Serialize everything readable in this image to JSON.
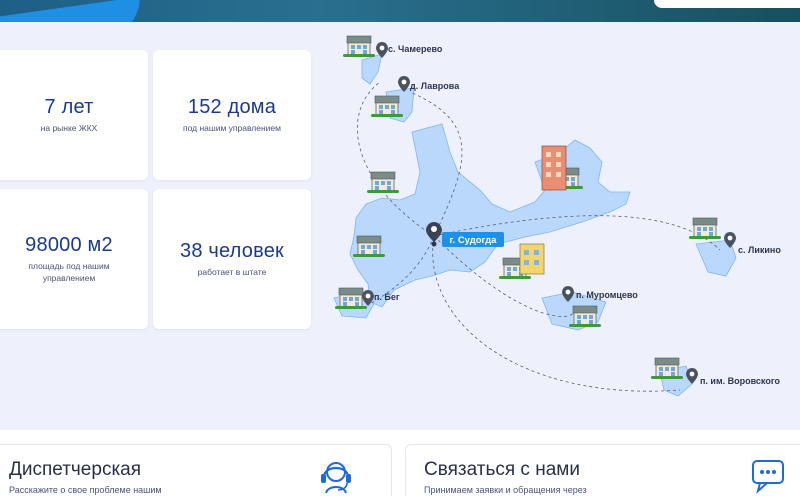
{
  "stats": [
    {
      "value": "7 лет",
      "label": "на рынке ЖКХ"
    },
    {
      "value": "152 дома",
      "label": "под нашим управлением"
    },
    {
      "value": "98000 м2",
      "label": "площадь под нашим управлением"
    },
    {
      "value": "38 человек",
      "label": "работает в штате"
    }
  ],
  "map": {
    "center_label": "г. Судогда",
    "places": [
      "с. Чамерево",
      "д. Лаврова",
      "п. Бег",
      "п. Муромцево",
      "с. Ликино",
      "п. им. Воровского"
    ]
  },
  "bottom": {
    "dispatch_title": "Диспетчерская",
    "dispatch_text": "Расскажите о свое проблеме нашим",
    "contact_title": "Связаться с нами",
    "contact_text": "Принимаем заявки и обращения через"
  },
  "colors": {
    "accent": "#1a3a8a",
    "water": "#b9d8fb",
    "center_badge": "#1e90e6",
    "bg": "#eef0fb"
  },
  "icons": [
    "map-pin-icon",
    "headset-icon",
    "chat-bubble-icon"
  ]
}
